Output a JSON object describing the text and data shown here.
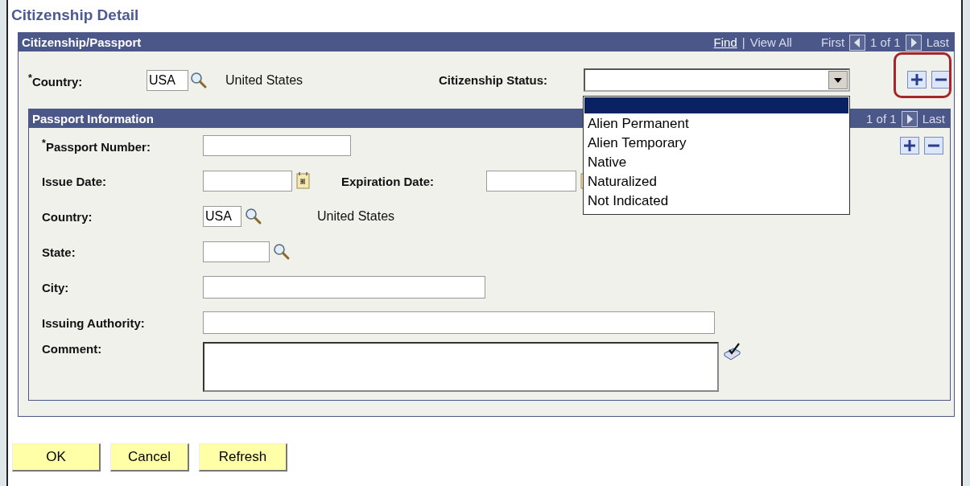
{
  "page_title": "Citizenship Detail",
  "citizenship": {
    "title": "Citizenship/Passport",
    "nav": {
      "find": "Find",
      "separator": "|",
      "view_all": "View All",
      "first": "First",
      "count": "1 of 1",
      "last": "Last"
    },
    "country": {
      "label": "$^{*}$Country:",
      "value": "USA",
      "description": "United States"
    },
    "status": {
      "label": "Citizenship Status:",
      "expanded": true,
      "empty_option": {
        "selected": true
      },
      "options": [
        {
          "label": "Alien Permanent",
          "selected": false
        },
        {
          "label": "Alien Temporary",
          "selected": false
        },
        {
          "label": "Native",
          "selected": false
        },
        {
          "label": "Naturalized",
          "selected": false
        },
        {
          "label": "Not Indicated",
          "selected": false
        }
      ]
    }
  },
  "passport": {
    "title": "Passport Information",
    "nav": {
      "count": "1 of 1",
      "last": "Last"
    },
    "rows": [
      {
        "kind": "text",
        "label": "$^{*}$Passport Number:"
      },
      {
        "kind": "dates",
        "label": "Issue Date:",
        "second_label": "Expiration Date:"
      },
      {
        "kind": "lookup",
        "label": "Country:",
        "value": "USA",
        "description": "United States"
      },
      {
        "kind": "lookup",
        "label": "State:"
      },
      {
        "kind": "text",
        "label": "City:"
      },
      {
        "kind": "text",
        "label": "Issuing Authority:"
      },
      {
        "kind": "textarea",
        "label": "Comment:"
      }
    ]
  },
  "buttons": [
    "OK",
    "Cancel",
    "Refresh"
  ]
}
